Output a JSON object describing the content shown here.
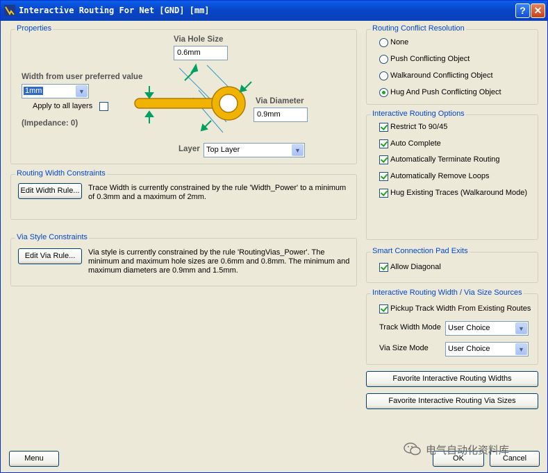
{
  "window": {
    "title": "Interactive Routing For Net [GND] [mm]",
    "help_label": "?",
    "close_label": "✕"
  },
  "properties": {
    "group_title": "Properties",
    "via_hole_size_label": "Via Hole Size",
    "via_hole_size_value": "0.6mm",
    "width_label": "Width from user preferred value",
    "width_value": "1mm",
    "apply_all_layers_label": "Apply to all layers",
    "apply_all_layers_checked": false,
    "impedance_text": "(Impedance: 0)",
    "via_diameter_label": "Via Diameter",
    "via_diameter_value": "0.9mm",
    "layer_label": "Layer",
    "layer_value": "Top Layer",
    "diagram_colors": {
      "via": "#F0B400",
      "via_outline": "#B07800",
      "arrow": "#00A060",
      "dim_line": "#3399CC"
    }
  },
  "routing_width": {
    "group_title": "Routing Width Constraints",
    "button_label": "Edit Width Rule...",
    "description": "Trace Width is currently constrained by the rule 'Width_Power' to a minimum of 0.3mm and a maximum of 2mm."
  },
  "via_style": {
    "group_title": "Via Style Constraints",
    "button_label": "Edit Via Rule...",
    "description": "Via style is currently constrained by the rule 'RoutingVias_Power'. The minimum and maximum hole sizes are 0.6mm and 0.8mm. The minimum and maximum diameters are 0.9mm and 1.5mm."
  },
  "conflict": {
    "group_title": "Routing Conflict Resolution",
    "options": [
      {
        "label": "None",
        "checked": false
      },
      {
        "label": "Push Conflicting Object",
        "checked": false
      },
      {
        "label": "Walkaround Conflicting Object",
        "checked": false
      },
      {
        "label": "Hug And Push Conflicting Object",
        "checked": true
      }
    ]
  },
  "routing_options": {
    "group_title": "Interactive Routing Options",
    "options": [
      {
        "label": "Restrict To 90/45",
        "checked": true
      },
      {
        "label": "Auto Complete",
        "checked": true
      },
      {
        "label": "Automatically Terminate Routing",
        "checked": true
      },
      {
        "label": "Automatically Remove Loops",
        "checked": true
      },
      {
        "label": "Hug Existing Traces (Walkaround Mode)",
        "checked": true
      }
    ]
  },
  "pad_exits": {
    "group_title": "Smart Connection Pad Exits",
    "allow_diagonal_label": "Allow Diagonal",
    "allow_diagonal_checked": true
  },
  "size_sources": {
    "group_title": "Interactive Routing Width / Via Size Sources",
    "pickup_label": "Pickup Track Width From Existing Routes",
    "pickup_checked": true,
    "track_width_mode_label": "Track Width Mode",
    "track_width_mode_value": "User Choice",
    "via_size_mode_label": "Via Size Mode",
    "via_size_mode_value": "User Choice"
  },
  "favorites": {
    "widths_label": "Favorite Interactive Routing Widths",
    "via_sizes_label": "Favorite Interactive Routing Via Sizes"
  },
  "footer": {
    "menu_label": "Menu",
    "ok_label": "OK",
    "cancel_label": "Cancel",
    "watermark": "电气自动化资料库"
  }
}
